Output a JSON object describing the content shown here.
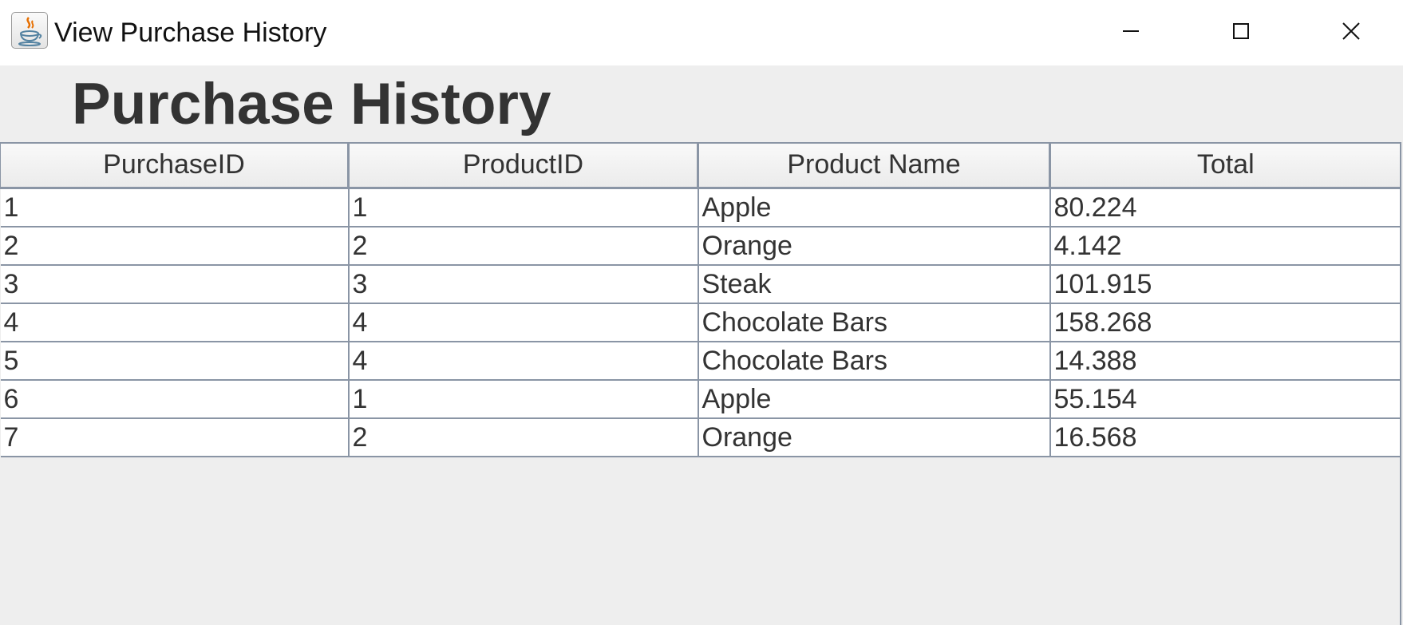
{
  "window": {
    "title": "View Purchase History",
    "icon": "java-coffee-cup-icon",
    "controls": [
      "minimize-icon",
      "maximize-icon",
      "close-icon"
    ]
  },
  "heading": "Purchase History",
  "table": {
    "columns": [
      "PurchaseID",
      "ProductID",
      "Product Name",
      "Total"
    ],
    "rows": [
      [
        "1",
        "1",
        "Apple",
        "80.224"
      ],
      [
        "2",
        "2",
        "Orange",
        "4.142"
      ],
      [
        "3",
        "3",
        "Steak",
        "101.915"
      ],
      [
        "4",
        "4",
        "Chocolate Bars",
        "158.268"
      ],
      [
        "5",
        "4",
        "Chocolate Bars",
        "14.388"
      ],
      [
        "6",
        "1",
        "Apple",
        "55.154"
      ],
      [
        "7",
        "2",
        "Orange",
        "16.568"
      ]
    ]
  },
  "colors": {
    "title_bar": "#ffffff",
    "background": "#eeeeee",
    "grid_line": "#8a95a5",
    "text": "#333333"
  }
}
